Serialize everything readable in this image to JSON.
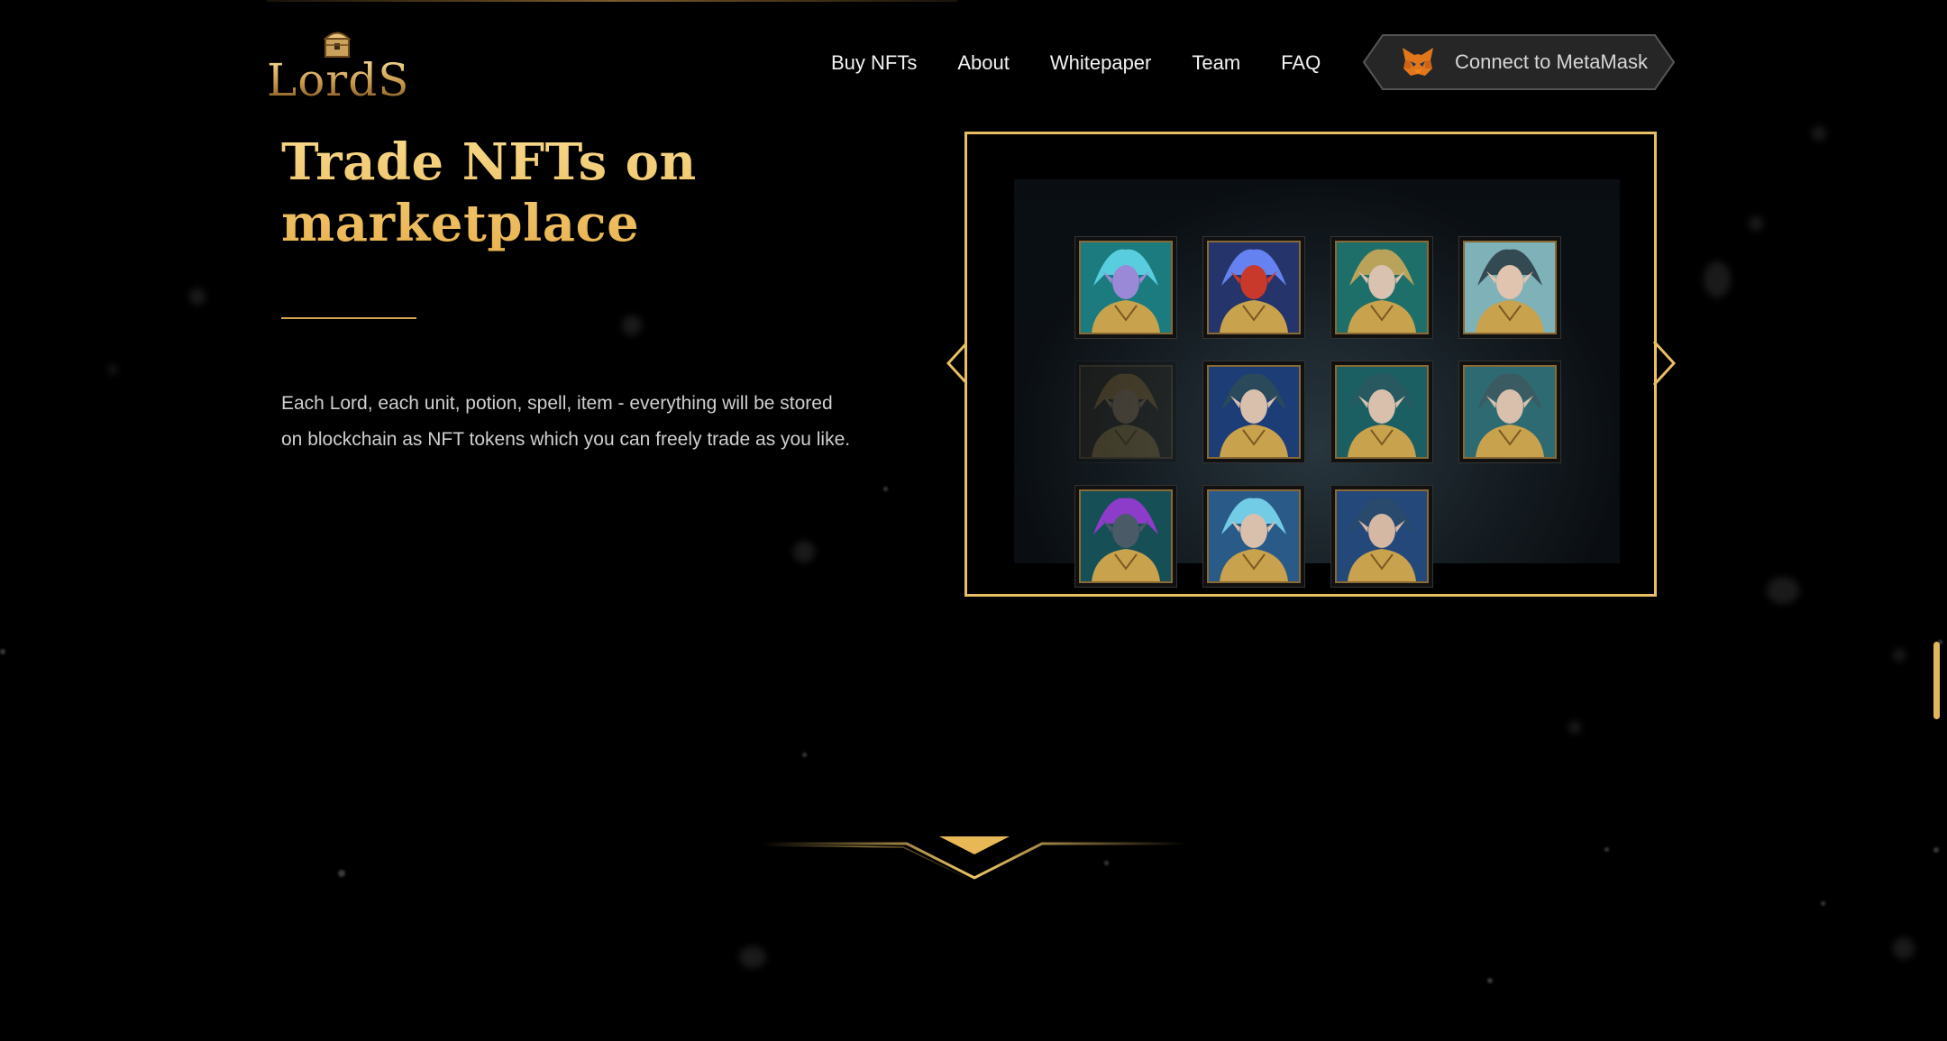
{
  "header": {
    "logo_text": "LordS",
    "nav": [
      {
        "label": "Buy NFTs"
      },
      {
        "label": "About"
      },
      {
        "label": "Whitepaper"
      },
      {
        "label": "Team"
      },
      {
        "label": "FAQ"
      }
    ],
    "connect_button": {
      "label": "Connect to MetaMask",
      "icon": "metamask-fox-icon"
    }
  },
  "hero": {
    "title": "Trade NFTs on marketplace",
    "description": "Each Lord, each unit, potion, spell, item - everything will be stored on blockchain as NFT tokens which you can freely trade as you like."
  },
  "gallery": {
    "cards": [
      {
        "bg": "#1b7b7e",
        "skin": "#9a89d6",
        "hair": "#5fd6e8",
        "highlight": false
      },
      {
        "bg": "#25346a",
        "skin": "#c8392b",
        "hair": "#6c8cff",
        "highlight": false
      },
      {
        "bg": "#1e6f6a",
        "skin": "#d9c2b0",
        "hair": "#caa95a",
        "highlight": false
      },
      {
        "bg": "#7fb1b9",
        "skin": "#e0c4b0",
        "hair": "#2c3f48",
        "highlight": false
      },
      {
        "bg": "#3a3020",
        "skin": "#c9a070",
        "hair": "#d8a040",
        "highlight": true
      },
      {
        "bg": "#1d3d77",
        "skin": "#d8c0ad",
        "hair": "#2c4a58",
        "highlight": false
      },
      {
        "bg": "#1c5f62",
        "skin": "#d8c0ad",
        "hair": "#2a5860",
        "highlight": false
      },
      {
        "bg": "#2d6a72",
        "skin": "#d8c0ad",
        "hair": "#3d5a62",
        "highlight": false
      },
      {
        "bg": "#174f56",
        "skin": "#4a5a66",
        "hair": "#9a3ad6",
        "highlight": false
      },
      {
        "bg": "#2a5a88",
        "skin": "#d8c0ad",
        "hair": "#7ad8f0",
        "highlight": false
      },
      {
        "bg": "#24487a",
        "skin": "#d4b8a4",
        "hair": "#2a4a6a",
        "highlight": false
      }
    ]
  },
  "colors": {
    "accent": "#e8bf63",
    "background": "#000000",
    "button_bg": "#2a2a2a"
  }
}
